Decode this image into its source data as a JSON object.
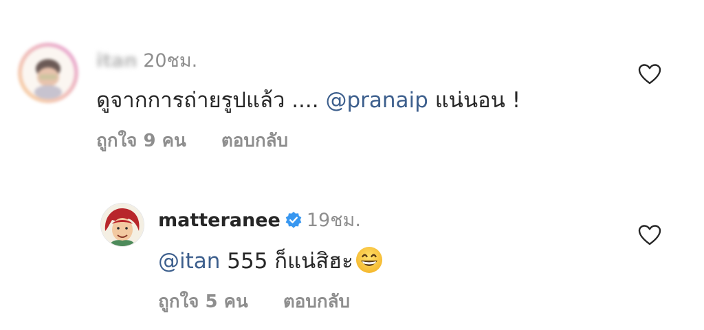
{
  "comments": [
    {
      "username": "itan",
      "time": "20ชม.",
      "text_before": "ดูจากการถ่ายรูปแล้ว .... ",
      "mention": "@pranaip",
      "text_after": " แน่นอน !",
      "likes": "ถูกใจ 9 คน",
      "reply_label": "ตอบกลับ",
      "verified": false
    },
    {
      "username": "matteranee",
      "time": "19ชม.",
      "mention": "@itan",
      "text_after": " 555 ก็แน่สิฮะ",
      "emoji": "grinning-face",
      "likes": "ถูกใจ 5 คน",
      "reply_label": "ตอบกลับ",
      "verified": true
    }
  ],
  "colors": {
    "text": "#262626",
    "muted": "#8e8e8e",
    "mention": "#3d5f8d",
    "verified": "#3897f0"
  }
}
